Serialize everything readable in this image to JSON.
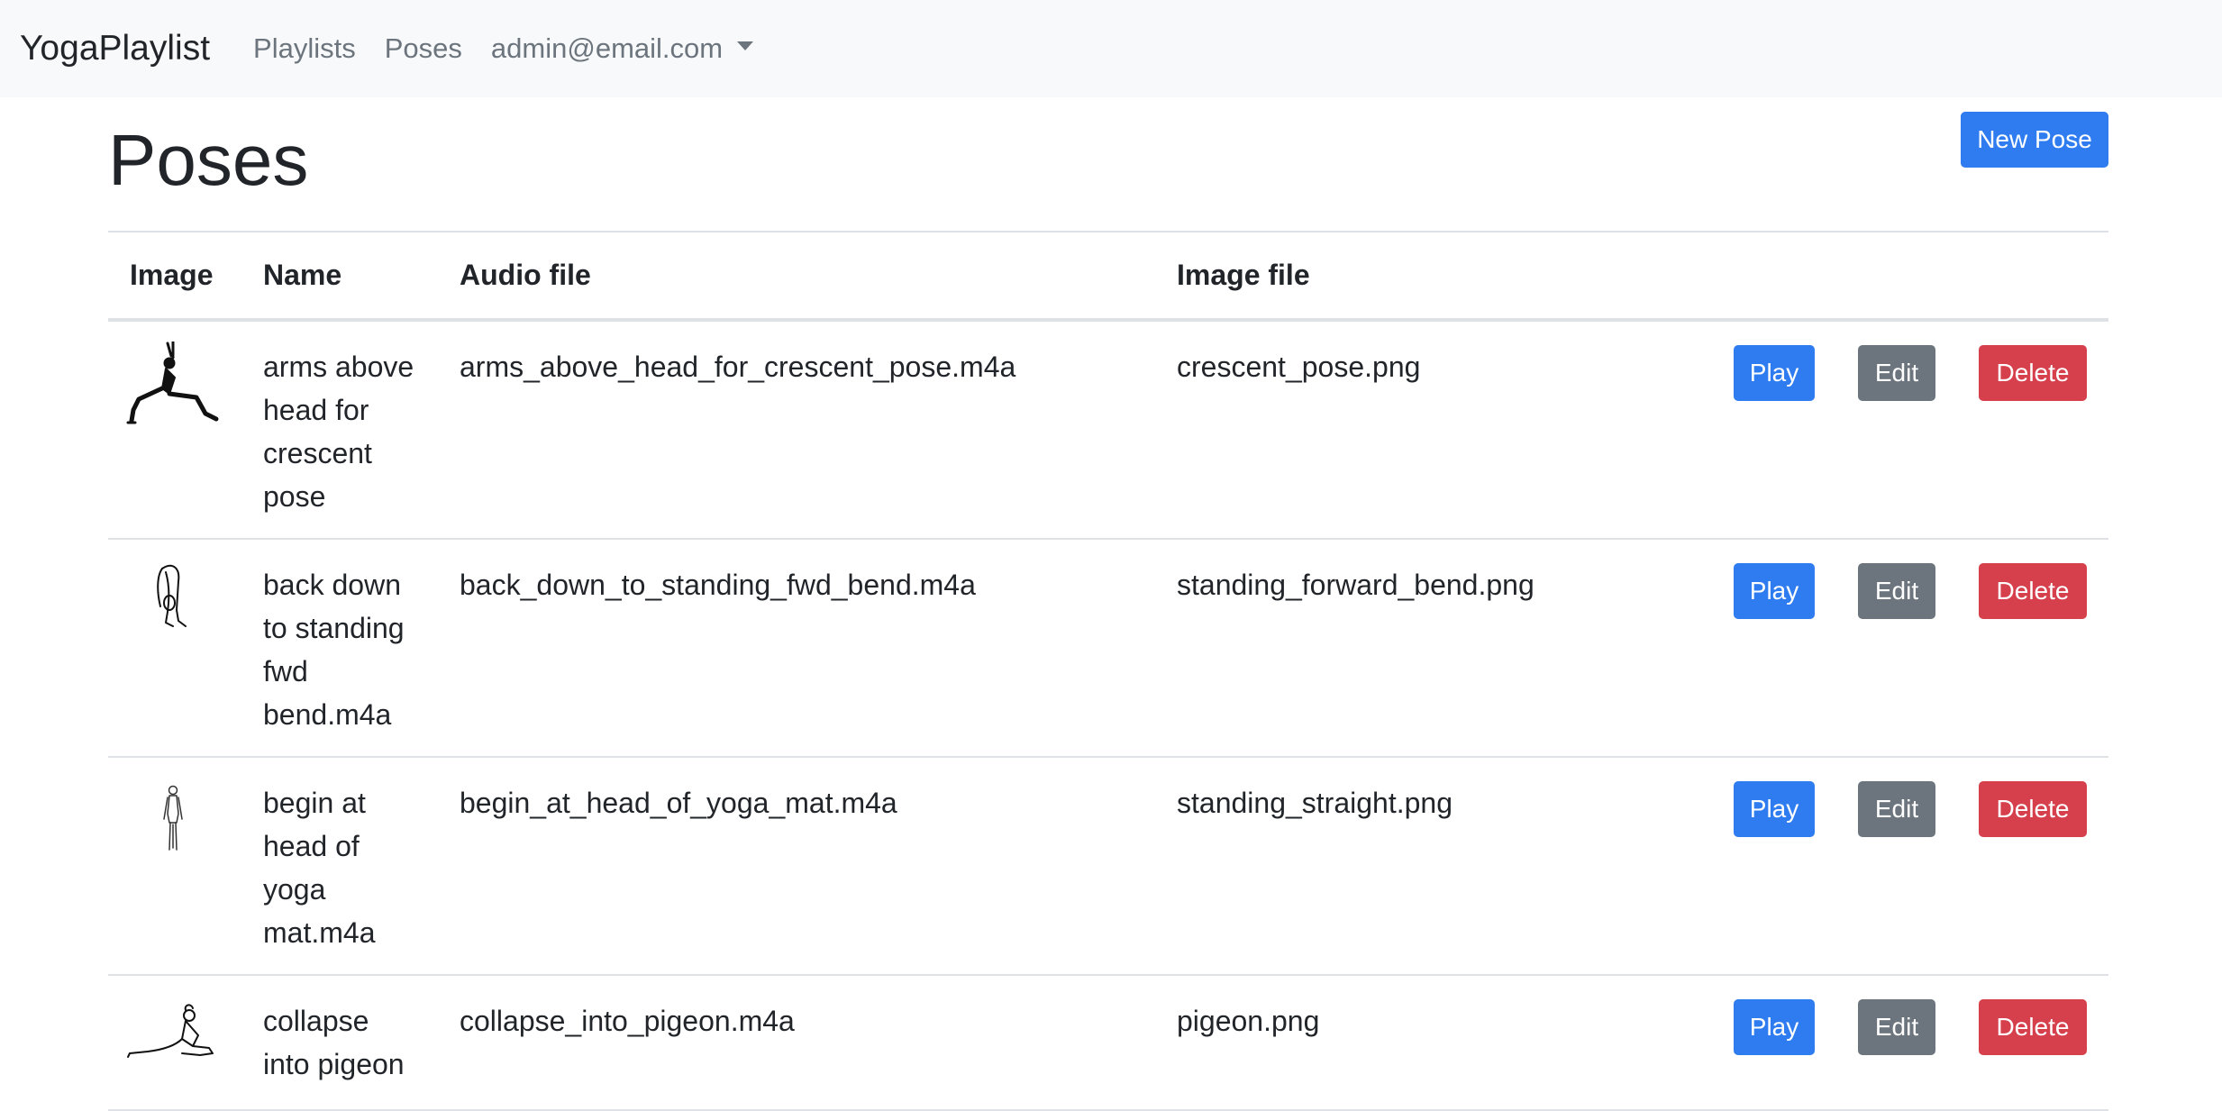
{
  "navbar": {
    "brand": "YogaPlaylist",
    "links": [
      {
        "label": "Playlists"
      },
      {
        "label": "Poses"
      }
    ],
    "user_menu": "admin@email.com"
  },
  "page": {
    "title": "Poses",
    "new_button": "New Pose"
  },
  "table": {
    "headers": [
      "Image",
      "Name",
      "Audio file",
      "Image file"
    ],
    "rows": [
      {
        "name": "arms above head for crescent pose",
        "audio_file": "arms_above_head_for_crescent_pose.m4a",
        "image_file": "crescent_pose.png",
        "icon": "crescent-pose-icon"
      },
      {
        "name": "back down to standing fwd bend.m4a",
        "audio_file": "back_down_to_standing_fwd_bend.m4a",
        "image_file": "standing_forward_bend.png",
        "icon": "standing-forward-bend-icon"
      },
      {
        "name": "begin at head of yoga mat.m4a",
        "audio_file": "begin_at_head_of_yoga_mat.m4a",
        "image_file": "standing_straight.png",
        "icon": "standing-straight-icon"
      },
      {
        "name": "collapse into pigeon",
        "audio_file": "collapse_into_pigeon.m4a",
        "image_file": "pigeon.png",
        "icon": "pigeon-pose-icon"
      }
    ],
    "actions": {
      "play": "Play",
      "edit": "Edit",
      "delete": "Delete"
    }
  },
  "colors": {
    "primary": "#2f7cf0",
    "secondary": "#6c757d",
    "danger": "#d63f4c",
    "navbar_bg": "#f8f9fa"
  }
}
